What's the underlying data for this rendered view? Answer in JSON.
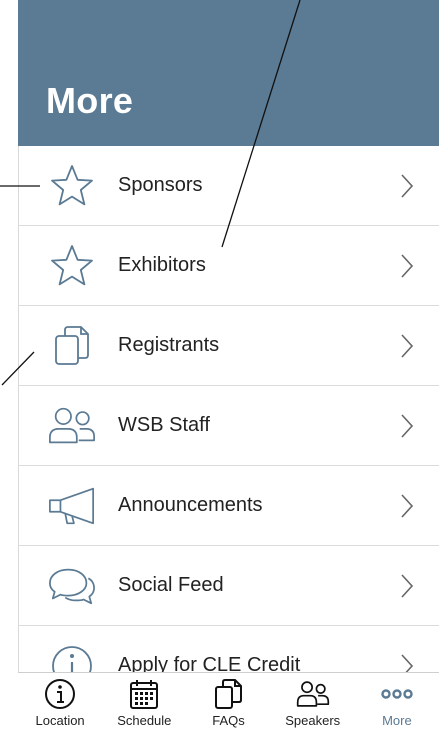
{
  "header": {
    "title": "More"
  },
  "menu": {
    "items": [
      {
        "label": "Sponsors",
        "icon": "star-icon"
      },
      {
        "label": "Exhibitors",
        "icon": "star-icon"
      },
      {
        "label": "Registrants",
        "icon": "documents-icon"
      },
      {
        "label": "WSB Staff",
        "icon": "people-icon"
      },
      {
        "label": "Announcements",
        "icon": "megaphone-icon"
      },
      {
        "label": "Social Feed",
        "icon": "chat-bubbles-icon"
      },
      {
        "label": "Apply for CLE Credit",
        "icon": "info-icon"
      }
    ]
  },
  "tabbar": {
    "tabs": [
      {
        "label": "Location",
        "icon": "info-icon"
      },
      {
        "label": "Schedule",
        "icon": "calendar-icon"
      },
      {
        "label": "FAQs",
        "icon": "documents-icon"
      },
      {
        "label": "Speakers",
        "icon": "people-icon"
      },
      {
        "label": "More",
        "icon": "more-dots-icon",
        "active": true
      }
    ]
  },
  "colors": {
    "header_bg": "#5b7a93",
    "icon_stroke": "#5b7a93",
    "active_tab": "#5b7a93",
    "text": "#222222"
  }
}
